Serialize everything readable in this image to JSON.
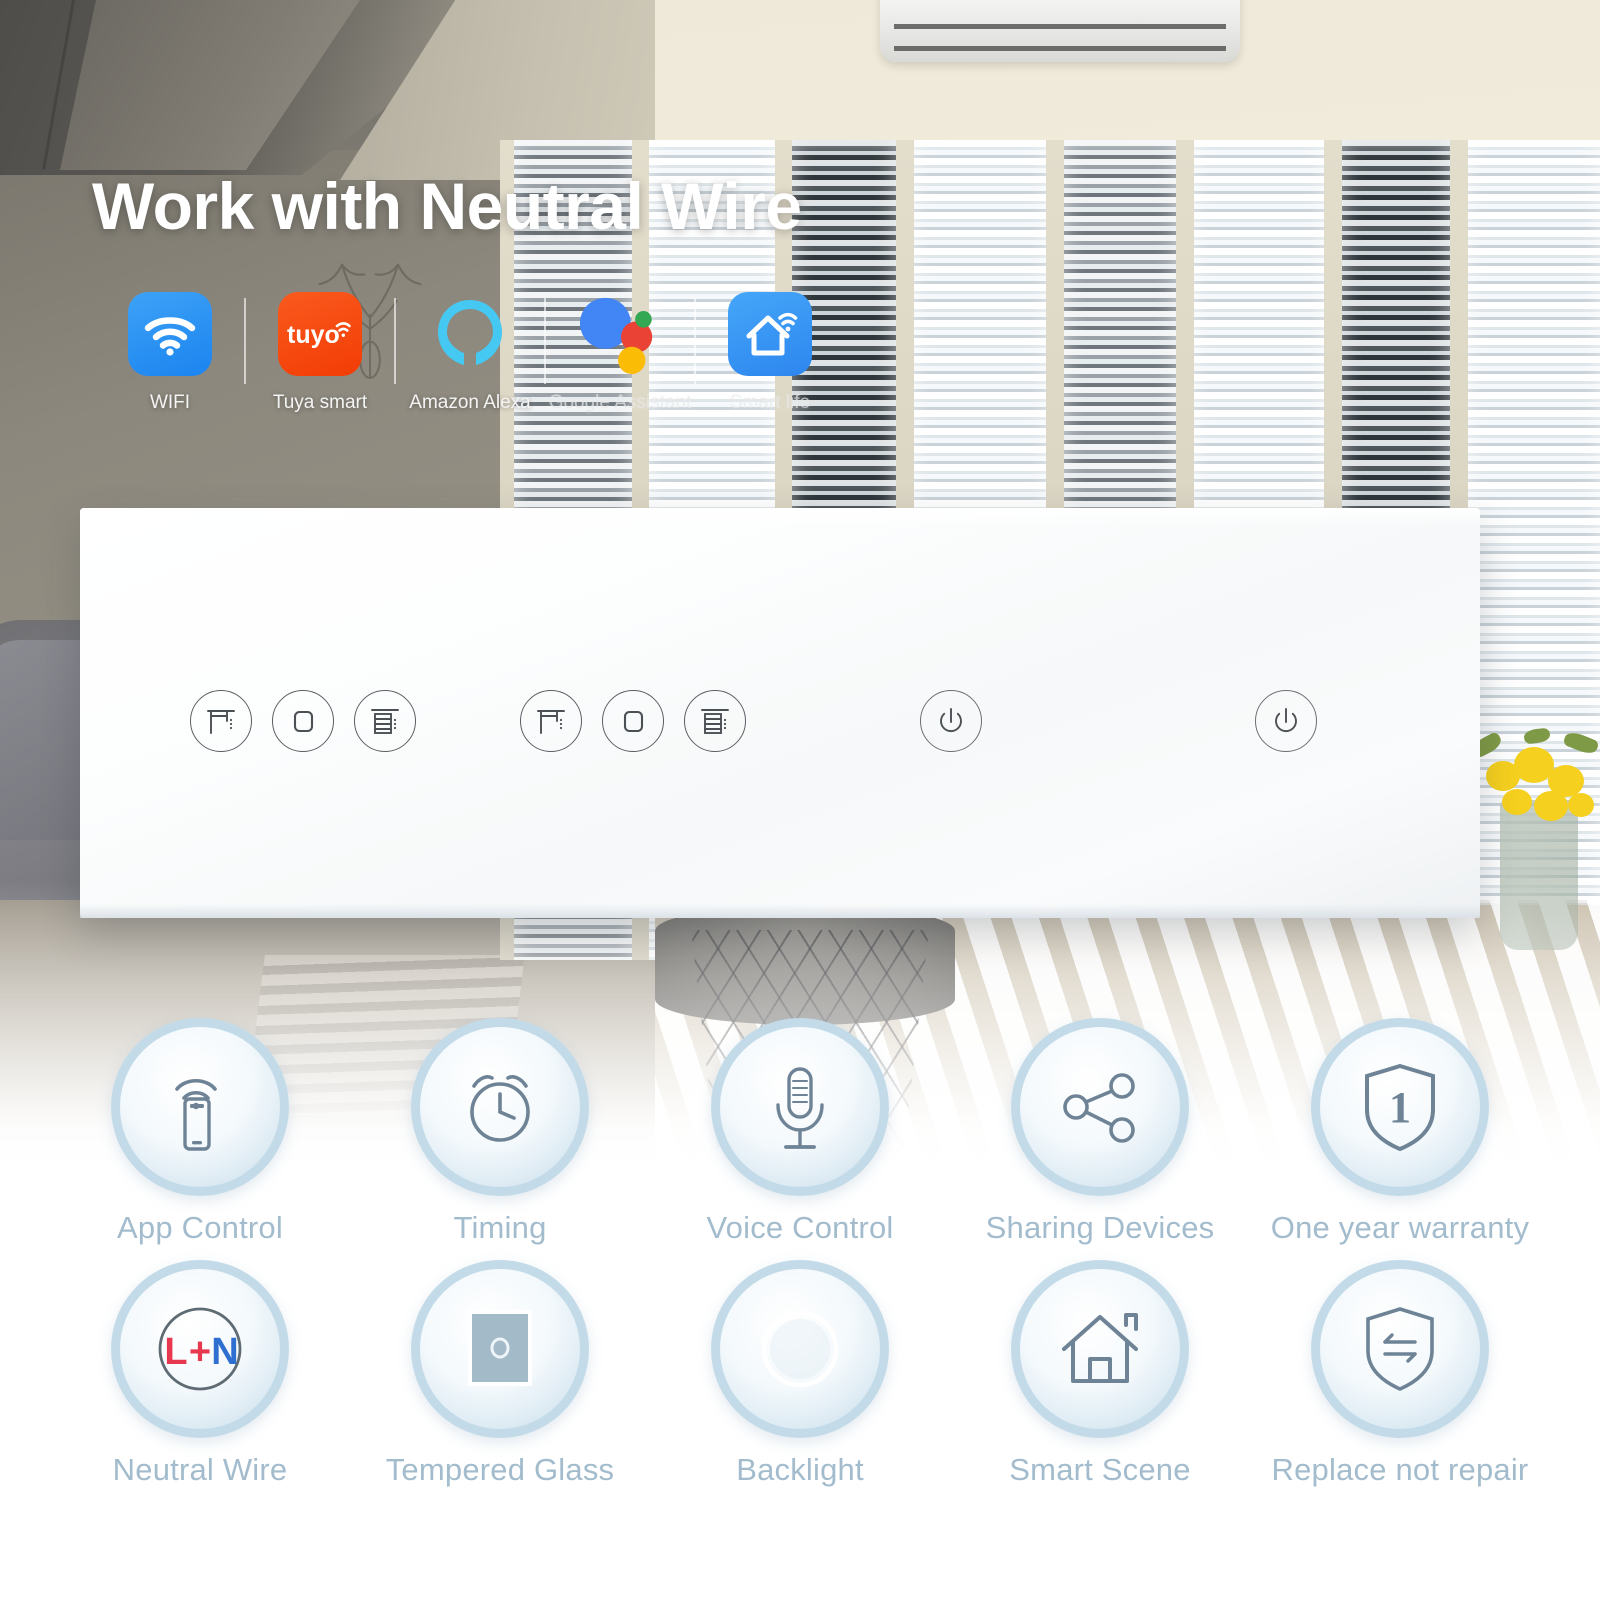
{
  "headline": "Work with Neutral Wire",
  "colors": {
    "wifi_blue": "#2196f3",
    "tuya_orange": "#f5400a",
    "alexa_cyan": "#45c8f1",
    "smartlife_blue": "#3399f3",
    "google_blue": "#4285f4",
    "google_red": "#ea4335",
    "google_yellow": "#fbbc05",
    "google_green": "#34a853",
    "feature_label": "#a3bccd",
    "feature_ring": "#c3dbe9",
    "icon_stroke": "#6e8496",
    "live_red": "#e8384f",
    "neutral_blue": "#2f6fd0"
  },
  "compat_badges": [
    {
      "id": "wifi",
      "label": "WIFI",
      "icon": "wifi-icon"
    },
    {
      "id": "tuya",
      "label": "Tuya smart",
      "icon": "tuya-logo-icon"
    },
    {
      "id": "alexa",
      "label": "Amazon Alexa",
      "icon": "alexa-ring-icon"
    },
    {
      "id": "google",
      "label": "Google Assistant",
      "icon": "google-assistant-dots-icon"
    },
    {
      "id": "smartlife",
      "label": "Smart life",
      "icon": "smart-life-house-icon"
    }
  ],
  "switch_panel": {
    "groups": [
      {
        "id": "curtain-1",
        "type": "curtain",
        "keys": [
          "curtain-open-icon",
          "curtain-stop-icon",
          "curtain-close-icon"
        ]
      },
      {
        "id": "curtain-2",
        "type": "curtain",
        "keys": [
          "curtain-open-icon",
          "curtain-stop-icon",
          "curtain-close-icon"
        ]
      },
      {
        "id": "switch-1",
        "type": "power",
        "keys": [
          "power-icon"
        ]
      },
      {
        "id": "switch-2",
        "type": "power",
        "keys": [
          "power-icon"
        ]
      }
    ]
  },
  "features_row1": [
    {
      "label": "App Control",
      "icon": "phone-signal-icon"
    },
    {
      "label": "Timing",
      "icon": "alarm-clock-icon"
    },
    {
      "label": "Voice Control",
      "icon": "microphone-icon"
    },
    {
      "label": "Sharing Devices",
      "icon": "share-nodes-icon"
    },
    {
      "label": "One year warranty",
      "icon": "shield-one-icon",
      "badge_number": "1"
    }
  ],
  "features_row2": [
    {
      "label": "Neutral Wire",
      "icon": "l-plus-n-icon",
      "text_live": "L",
      "text_plus": "+",
      "text_neutral": "N"
    },
    {
      "label": "Tempered Glass",
      "icon": "glass-panel-icon"
    },
    {
      "label": "Backlight",
      "icon": "backlight-ring-icon"
    },
    {
      "label": "Smart Scene",
      "icon": "home-icon"
    },
    {
      "label": "Replace not repair",
      "icon": "shield-swap-icon"
    }
  ]
}
